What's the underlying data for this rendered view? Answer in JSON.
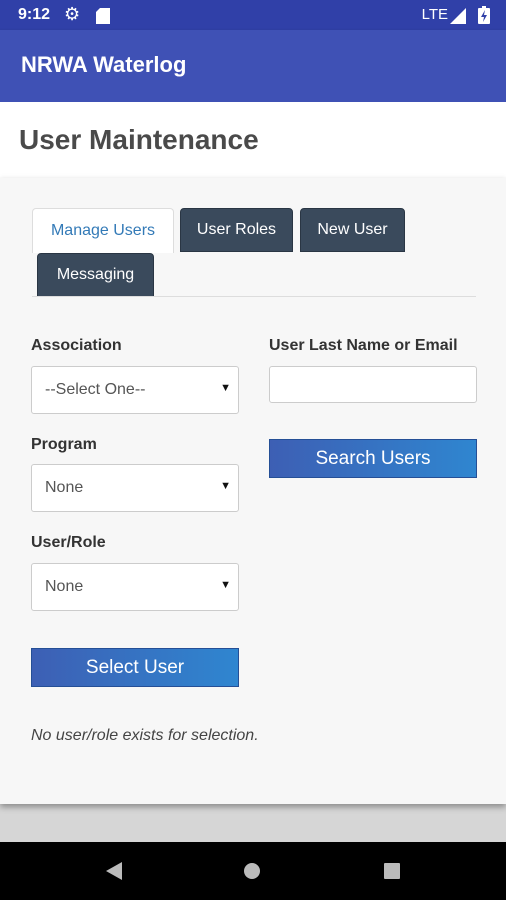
{
  "status_bar": {
    "time": "9:12",
    "network": "LTE",
    "icons": [
      "gear-icon",
      "sd-card-icon",
      "signal-icon",
      "battery-icon"
    ]
  },
  "app_bar": {
    "title": "NRWA Waterlog",
    "color": "#3f51b5"
  },
  "page": {
    "title": "User Maintenance"
  },
  "tabs": [
    {
      "label": "Manage Users",
      "active": true
    },
    {
      "label": "User Roles",
      "active": false
    },
    {
      "label": "New User",
      "active": false
    },
    {
      "label": "Messaging",
      "active": false
    }
  ],
  "form": {
    "association": {
      "label": "Association",
      "value": "--Select One--"
    },
    "program": {
      "label": "Program",
      "value": "None"
    },
    "user_role": {
      "label": "User/Role",
      "value": "None"
    },
    "search_field": {
      "label": "User Last Name or Email",
      "value": ""
    },
    "search_button": "Search Users",
    "select_button": "Select User",
    "note": "No user/role exists for selection."
  },
  "colors": {
    "accent": "#337ab7",
    "tab_dark": "#3a4a5c",
    "button": "#2f6fc0"
  }
}
